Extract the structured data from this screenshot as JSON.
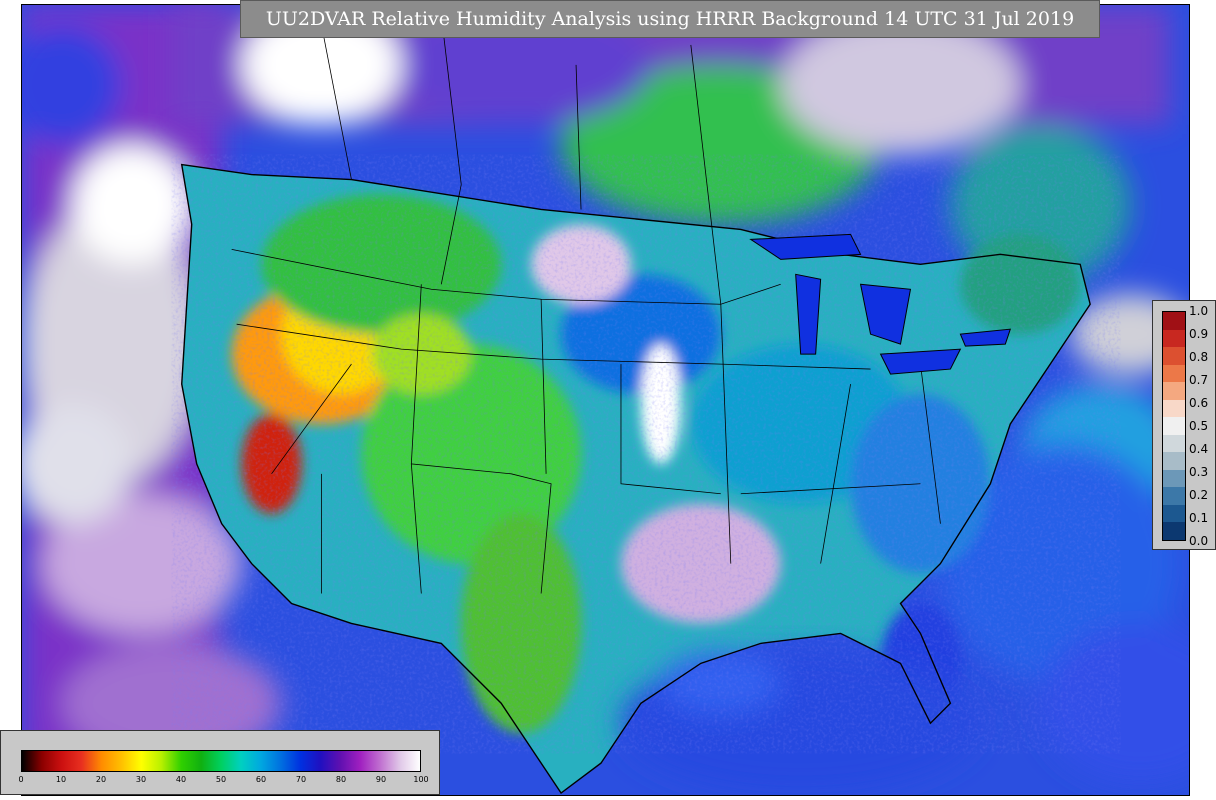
{
  "title": "UU2DVAR Relative Humidity Analysis using HRRR Background 14 UTC 31 Jul 2019",
  "rh_colorbar": {
    "ticks": [
      "0",
      "10",
      "20",
      "30",
      "40",
      "50",
      "60",
      "70",
      "80",
      "90",
      "100"
    ],
    "colors": [
      "#000000",
      "#8b0000",
      "#cc1010",
      "#e83020",
      "#ff8c00",
      "#ffc000",
      "#ffff00",
      "#b8f000",
      "#30d000",
      "#10b010",
      "#00d060",
      "#00d0c0",
      "#00a8e0",
      "#0070e0",
      "#0030e0",
      "#2010c0",
      "#6010b0",
      "#a020c0",
      "#c070d0",
      "#e0c8e8",
      "#ffffff"
    ]
  },
  "ratio_colorbar": {
    "ticks": [
      "1.0",
      "0.9",
      "0.8",
      "0.7",
      "0.6",
      "0.5",
      "0.4",
      "0.3",
      "0.2",
      "0.1",
      "0.0"
    ],
    "colors": [
      "#a01015",
      "#c82820",
      "#dc5030",
      "#ec7848",
      "#f4a880",
      "#f8d8c8",
      "#f0f0f0",
      "#d0d8dc",
      "#a8bcc8",
      "#6c98b8",
      "#3c78a8",
      "#1c5890",
      "#0c3870"
    ]
  }
}
